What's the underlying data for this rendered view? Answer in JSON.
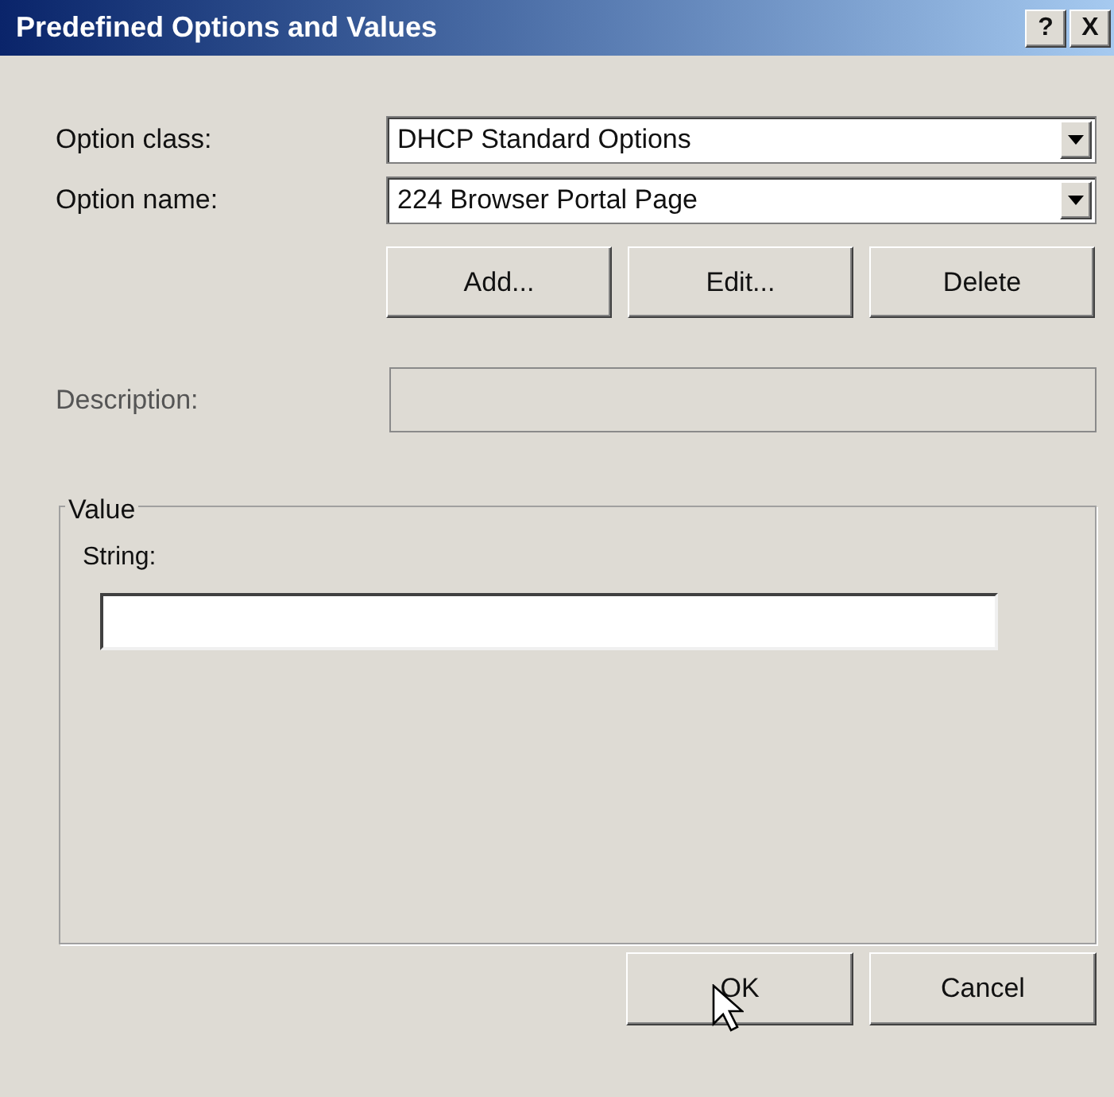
{
  "window": {
    "title": "Predefined Options and Values",
    "help_button": "?",
    "close_button": "X"
  },
  "fields": [
    {
      "label": "Option class:",
      "value": "DHCP Standard Options",
      "kind": "combo"
    },
    {
      "label": "Option name:",
      "value": "224 Browser Portal Page",
      "kind": "combo"
    }
  ],
  "option_buttons": [
    "Add...",
    "Edit...",
    "Delete"
  ],
  "description": {
    "label": "Description:",
    "disabled": true
  },
  "value_group": {
    "title": "Value",
    "string_label": "String:"
  },
  "buttons": [
    "OK",
    "Cancel"
  ]
}
